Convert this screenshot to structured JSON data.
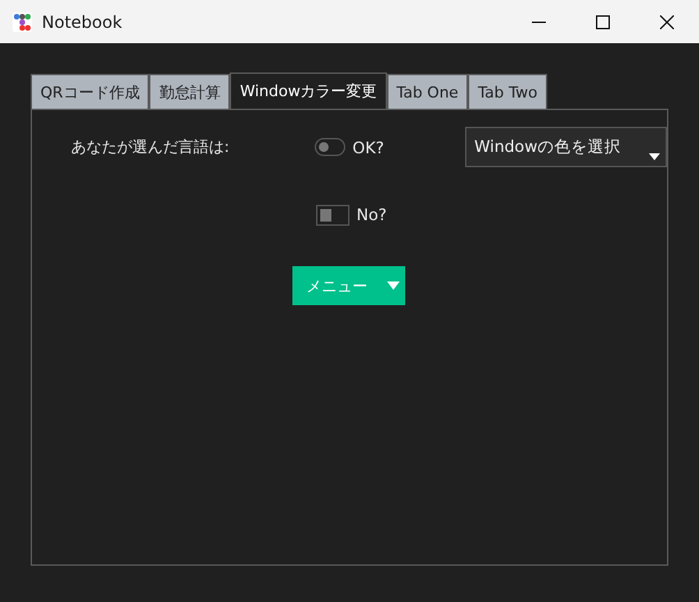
{
  "window": {
    "title": "Notebook"
  },
  "tabs": [
    {
      "label": "QRコード作成",
      "selected": false
    },
    {
      "label": "勤怠計算",
      "selected": false
    },
    {
      "label": "Windowカラー変更",
      "selected": true
    },
    {
      "label": "Tab One",
      "selected": false
    },
    {
      "label": "Tab Two",
      "selected": false
    }
  ],
  "label": "あなたが選んだ言語は:",
  "switches": [
    {
      "kind": "round",
      "label": "OK?",
      "on": false
    },
    {
      "kind": "square",
      "label": "No?",
      "on": false
    }
  ],
  "dropdown": {
    "value": "Windowの色を選択"
  },
  "menu_button": {
    "label": "メニュー"
  }
}
